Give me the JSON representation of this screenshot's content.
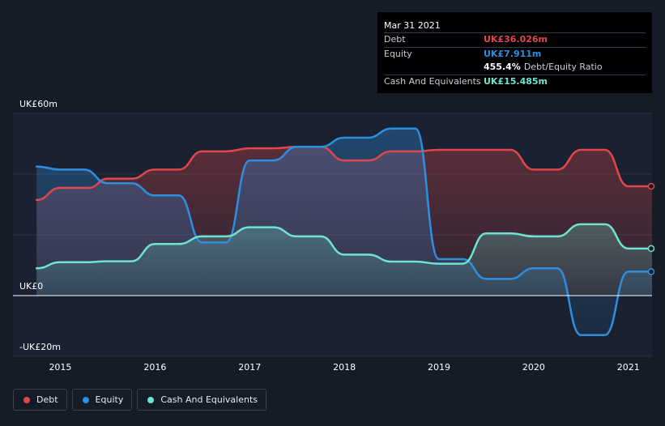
{
  "tooltip": {
    "date": "Mar 31 2021",
    "debt_label": "Debt",
    "debt_value": "UK£36.026m",
    "equity_label": "Equity",
    "equity_value": "UK£7.911m",
    "ratio_value": "455.4%",
    "ratio_label": "Debt/Equity Ratio",
    "cash_label": "Cash And Equivalents",
    "cash_value": "UK£15.485m"
  },
  "legend": [
    {
      "label": "Debt",
      "color": "#e0474c"
    },
    {
      "label": "Equity",
      "color": "#2e8fe0"
    },
    {
      "label": "Cash And Equivalents",
      "color": "#6fe3cf"
    }
  ],
  "colors": {
    "debt": "#e0474c",
    "equity": "#2e8fe0",
    "cash": "#6fe3cf",
    "background": "#151b27",
    "plot": "#1a2130"
  },
  "chart_data": {
    "type": "line",
    "ylim": [
      -20,
      60
    ],
    "xlim": [
      2014.5,
      2021.25
    ],
    "y_tick_labels": [
      {
        "value": 60,
        "label": "UK£60m"
      },
      {
        "value": 0,
        "label": "UK£0"
      },
      {
        "value": -20,
        "label": "-UK£20m"
      }
    ],
    "x_ticks": [
      {
        "value": 2015,
        "label": "2015"
      },
      {
        "value": 2016,
        "label": "2016"
      },
      {
        "value": 2017,
        "label": "2017"
      },
      {
        "value": 2018,
        "label": "2018"
      },
      {
        "value": 2019,
        "label": "2019"
      },
      {
        "value": 2020,
        "label": "2020"
      },
      {
        "value": 2021,
        "label": "2021"
      }
    ],
    "series": [
      {
        "key": "debt",
        "name": "Debt",
        "points": [
          [
            2014.75,
            31.5
          ],
          [
            2015.0,
            35.5
          ],
          [
            2015.3,
            35.5
          ],
          [
            2015.5,
            38.5
          ],
          [
            2015.75,
            38.5
          ],
          [
            2016.0,
            41.5
          ],
          [
            2016.25,
            41.5
          ],
          [
            2016.5,
            47.5
          ],
          [
            2016.75,
            47.5
          ],
          [
            2017.0,
            48.5
          ],
          [
            2017.25,
            48.5
          ],
          [
            2017.5,
            49.0
          ],
          [
            2017.75,
            49.0
          ],
          [
            2018.0,
            44.5
          ],
          [
            2018.25,
            44.5
          ],
          [
            2018.5,
            47.5
          ],
          [
            2018.75,
            47.5
          ],
          [
            2019.0,
            48.0
          ],
          [
            2019.25,
            48.0
          ],
          [
            2019.5,
            48.0
          ],
          [
            2019.75,
            48.0
          ],
          [
            2020.0,
            41.5
          ],
          [
            2020.25,
            41.5
          ],
          [
            2020.5,
            48.0
          ],
          [
            2020.75,
            48.0
          ],
          [
            2021.0,
            36.0
          ],
          [
            2021.25,
            36.0
          ]
        ]
      },
      {
        "key": "equity",
        "name": "Equity",
        "points": [
          [
            2014.75,
            42.5
          ],
          [
            2015.0,
            41.5
          ],
          [
            2015.25,
            41.5
          ],
          [
            2015.5,
            37.0
          ],
          [
            2015.75,
            37.0
          ],
          [
            2016.0,
            33.0
          ],
          [
            2016.25,
            33.0
          ],
          [
            2016.5,
            17.5
          ],
          [
            2016.75,
            17.5
          ],
          [
            2017.0,
            44.5
          ],
          [
            2017.25,
            44.5
          ],
          [
            2017.5,
            49.0
          ],
          [
            2017.75,
            49.0
          ],
          [
            2018.0,
            52.0
          ],
          [
            2018.25,
            52.0
          ],
          [
            2018.5,
            55.0
          ],
          [
            2018.75,
            55.0
          ],
          [
            2019.0,
            12.0
          ],
          [
            2019.25,
            12.0
          ],
          [
            2019.5,
            5.5
          ],
          [
            2019.75,
            5.5
          ],
          [
            2020.0,
            9.0
          ],
          [
            2020.25,
            9.0
          ],
          [
            2020.5,
            -13.0
          ],
          [
            2020.75,
            -13.0
          ],
          [
            2021.0,
            7.9
          ],
          [
            2021.25,
            7.9
          ]
        ]
      },
      {
        "key": "cash",
        "name": "Cash And Equivalents",
        "points": [
          [
            2014.75,
            9.0
          ],
          [
            2015.0,
            11.0
          ],
          [
            2015.25,
            11.0
          ],
          [
            2015.5,
            11.3
          ],
          [
            2015.75,
            11.3
          ],
          [
            2016.0,
            17.0
          ],
          [
            2016.25,
            17.0
          ],
          [
            2016.5,
            19.5
          ],
          [
            2016.75,
            19.5
          ],
          [
            2017.0,
            22.5
          ],
          [
            2017.25,
            22.5
          ],
          [
            2017.5,
            19.5
          ],
          [
            2017.75,
            19.5
          ],
          [
            2018.0,
            13.5
          ],
          [
            2018.25,
            13.5
          ],
          [
            2018.5,
            11.2
          ],
          [
            2018.75,
            11.2
          ],
          [
            2019.0,
            10.5
          ],
          [
            2019.25,
            10.5
          ],
          [
            2019.5,
            20.5
          ],
          [
            2019.75,
            20.5
          ],
          [
            2020.0,
            19.5
          ],
          [
            2020.25,
            19.5
          ],
          [
            2020.5,
            23.5
          ],
          [
            2020.75,
            23.5
          ],
          [
            2021.0,
            15.5
          ],
          [
            2021.25,
            15.5
          ]
        ]
      }
    ]
  }
}
